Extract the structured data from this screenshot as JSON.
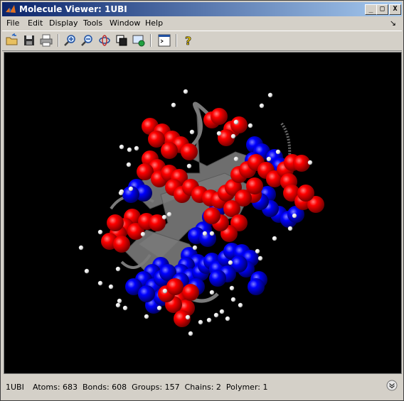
{
  "window": {
    "title": "Molecule Viewer: 1UBI",
    "controls": {
      "minimize": "_",
      "maximize": "□",
      "close": "X"
    }
  },
  "menubar": {
    "items": [
      "File",
      "Edit",
      "Display",
      "Tools",
      "Window",
      "Help"
    ],
    "dock_icon": "↘"
  },
  "toolbar": {
    "icons": [
      "open-icon",
      "save-icon",
      "print-icon",
      "zoom-in-icon",
      "zoom-out-icon",
      "rotate-icon",
      "show-hide-icon",
      "snapshot-icon",
      "command-window-icon",
      "help-icon"
    ]
  },
  "viewer": {
    "colors": {
      "oxygen": "#ff0000",
      "nitrogen": "#0000ff",
      "hydrogen": "#ffffff",
      "backbone": "#7a7a7a",
      "background": "#000000"
    }
  },
  "status": {
    "id": "1UBI",
    "stats": "Atoms: 683  Bonds: 608  Groups: 157  Chains: 2  Polymer: 1"
  }
}
